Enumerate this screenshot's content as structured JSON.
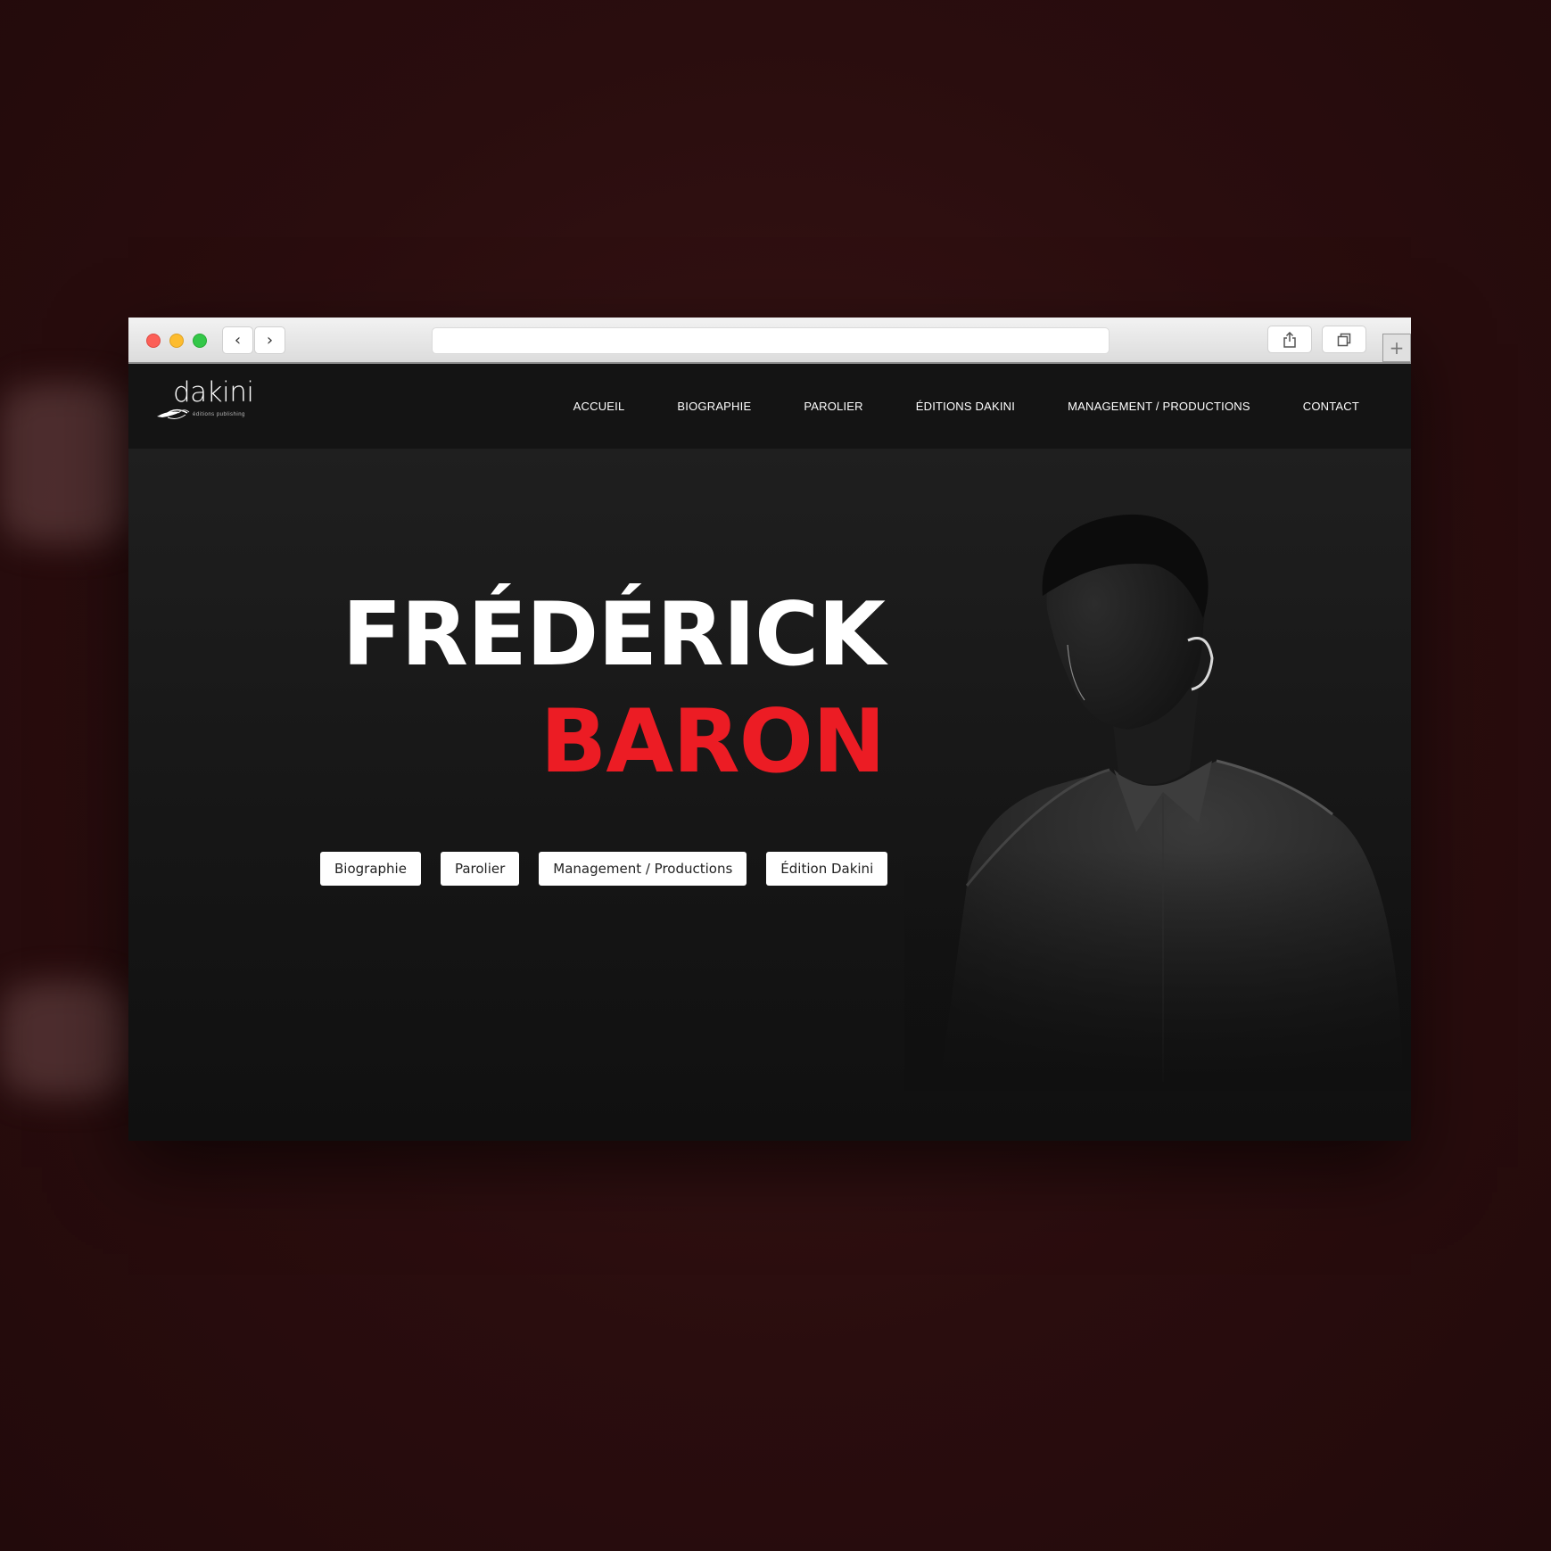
{
  "browser": {
    "url": "",
    "back_icon": "chevron-left-icon",
    "forward_icon": "chevron-right-icon",
    "share_icon": "share-icon",
    "tabs_icon": "tabs-icon",
    "new_tab_icon": "plus-icon"
  },
  "site": {
    "logo": {
      "name": "dakini",
      "tagline": "éditions publishing"
    },
    "nav": [
      "ACCUEIL",
      "BIOGRAPHIE",
      "PAROLIER",
      "ÉDITIONS DAKINI",
      "MANAGEMENT / PRODUCTIONS",
      "CONTACT"
    ]
  },
  "hero": {
    "first_name": "FRÉDÉRICK",
    "last_name": "BARON",
    "buttons": [
      "Biographie",
      "Parolier",
      "Management / Productions",
      "Édition Dakini"
    ]
  },
  "colors": {
    "accent": "#ec1c24",
    "background": "#141414",
    "backdrop": "#2a0d0e"
  }
}
